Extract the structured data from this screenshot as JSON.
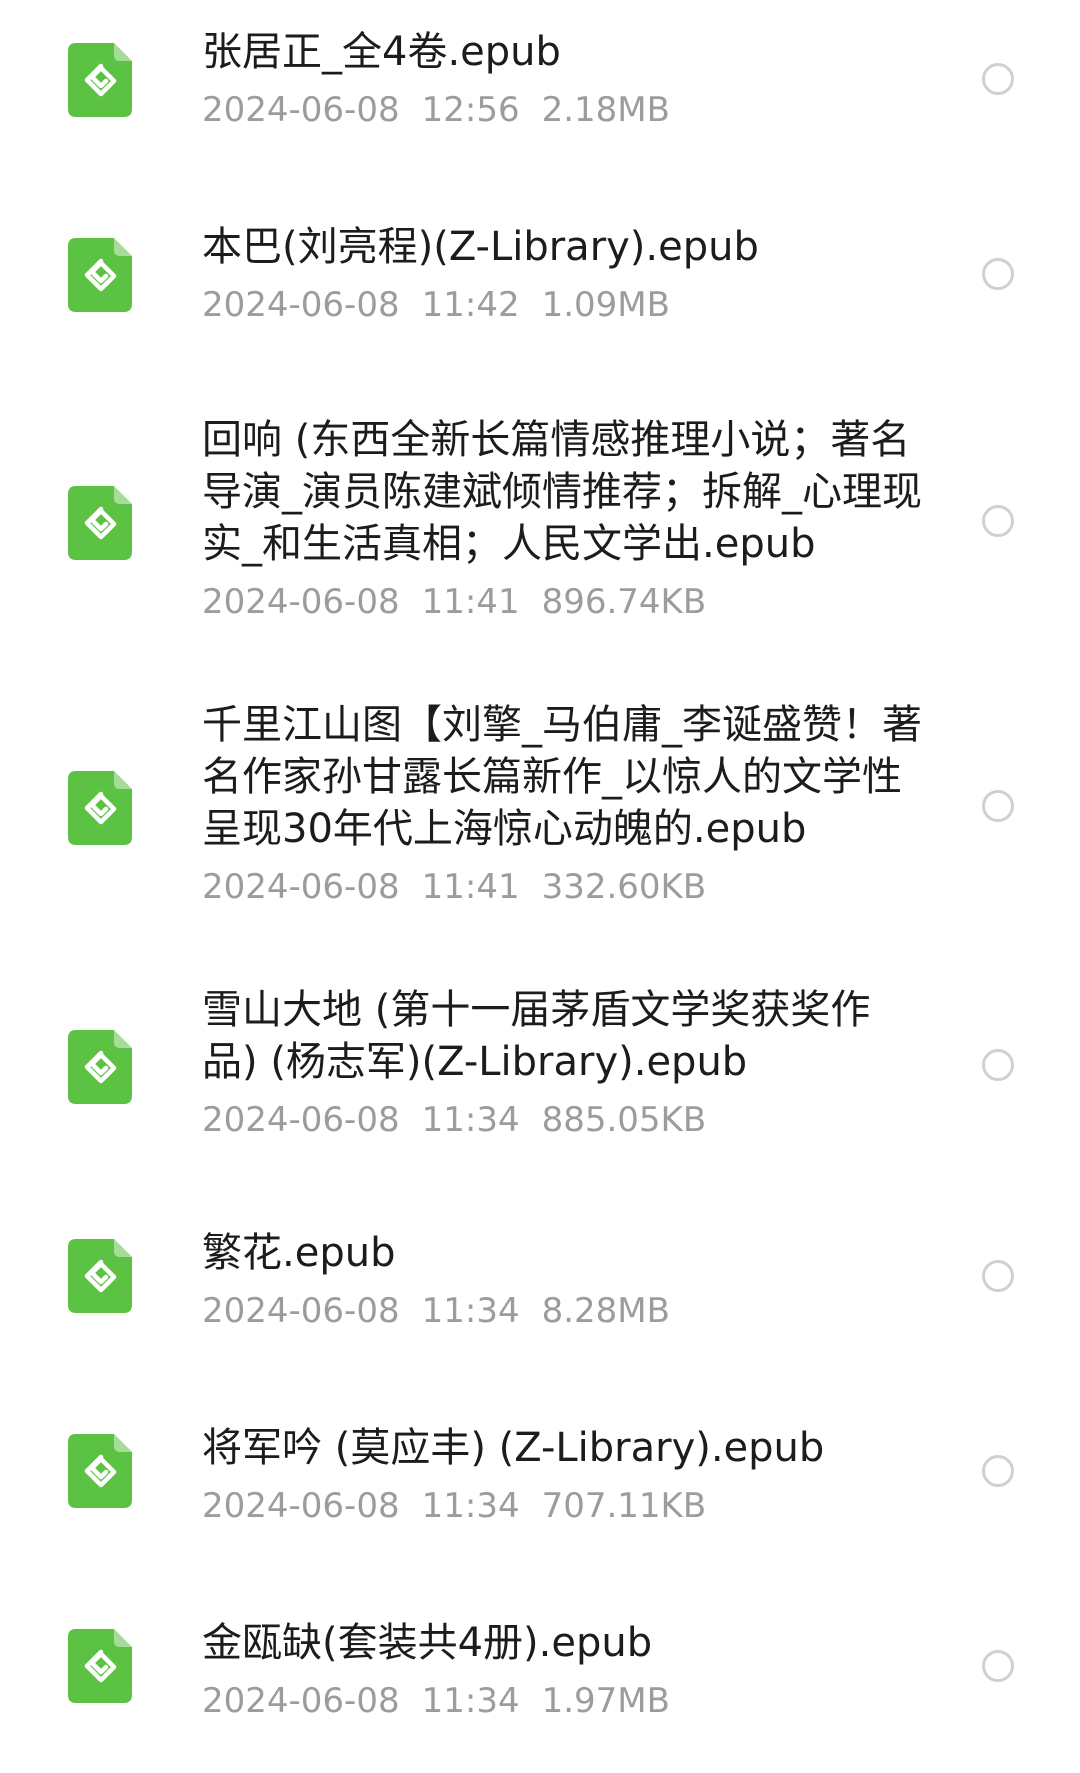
{
  "colors": {
    "epub_icon": "#5cc244",
    "file_name": "#1c1c1c",
    "file_meta": "#9c9c9c",
    "radio_border": "#d0d0d0"
  },
  "files": [
    {
      "name": "张居正_全4卷.epub",
      "date": "2024-06-08",
      "time": "12:56",
      "size": "2.18MB",
      "icon": "epub-file-icon"
    },
    {
      "name": "本巴(刘亮程)(Z-Library).epub",
      "date": "2024-06-08",
      "time": "11:42",
      "size": "1.09MB",
      "icon": "epub-file-icon"
    },
    {
      "name": "回响 (东西全新长篇情感推理小说；著名导演_演员陈建斌倾情推荐；拆解_心理现实_和生活真相；人民文学出.epub",
      "date": "2024-06-08",
      "time": "11:41",
      "size": "896.74KB",
      "icon": "epub-file-icon"
    },
    {
      "name": "千里江山图【刘擎_马伯庸_李诞盛赞！著名作家孙甘露长篇新作_以惊人的文学性呈现30年代上海惊心动魄的.epub",
      "date": "2024-06-08",
      "time": "11:41",
      "size": "332.60KB",
      "icon": "epub-file-icon"
    },
    {
      "name": "雪山大地 (第十一届茅盾文学奖获奖作品) (杨志军)(Z-Library).epub",
      "date": "2024-06-08",
      "time": "11:34",
      "size": "885.05KB",
      "icon": "epub-file-icon"
    },
    {
      "name": "繁花.epub",
      "date": "2024-06-08",
      "time": "11:34",
      "size": "8.28MB",
      "icon": "epub-file-icon"
    },
    {
      "name": "将军吟 (莫应丰) (Z-Library).epub",
      "date": "2024-06-08",
      "time": "11:34",
      "size": "707.11KB",
      "icon": "epub-file-icon"
    },
    {
      "name": "金瓯缺(套装共4册).epub",
      "date": "2024-06-08",
      "time": "11:34",
      "size": "1.97MB",
      "icon": "epub-file-icon"
    }
  ]
}
